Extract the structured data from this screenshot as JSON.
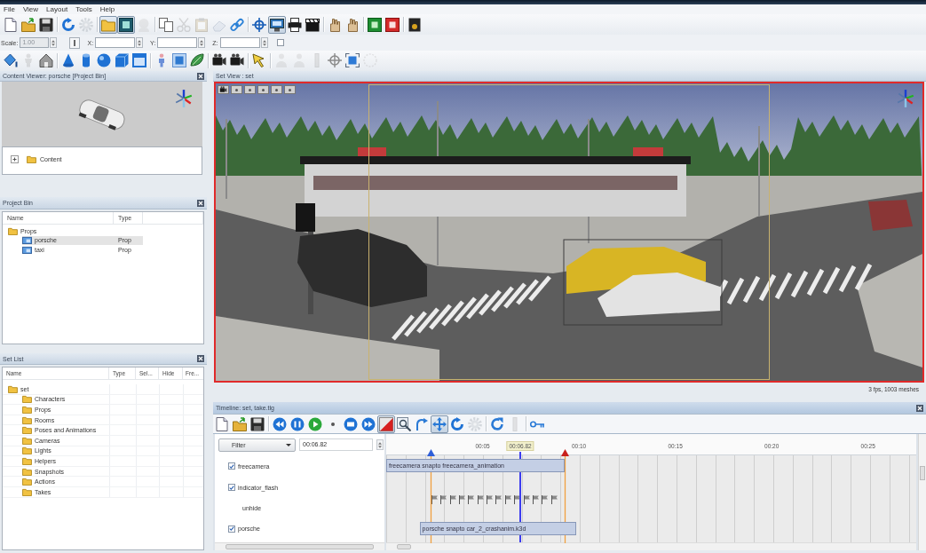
{
  "menu": [
    "File",
    "View",
    "Layout",
    "Tools",
    "Help"
  ],
  "toolbars": {
    "main": [
      {
        "kind": "button",
        "pressed": false,
        "disabled": false
      },
      {
        "kind": "button",
        "pressed": false,
        "disabled": false
      },
      {
        "kind": "button",
        "pressed": false,
        "disabled": false
      },
      {
        "kind": "separator"
      },
      {
        "kind": "button",
        "pressed": false,
        "disabled": false
      },
      {
        "kind": "button",
        "pressed": false,
        "disabled": true
      },
      {
        "kind": "separator"
      },
      {
        "kind": "button",
        "pressed": true,
        "disabled": false
      },
      {
        "kind": "button",
        "pressed": true,
        "disabled": false
      },
      {
        "kind": "button",
        "pressed": false,
        "disabled": true
      },
      {
        "kind": "separator"
      },
      {
        "kind": "button",
        "pressed": false,
        "disabled": false
      },
      {
        "kind": "button",
        "pressed": false,
        "disabled": true
      },
      {
        "kind": "button",
        "pressed": false,
        "disabled": true
      },
      {
        "kind": "button",
        "pressed": false,
        "disabled": true
      },
      {
        "kind": "button",
        "pressed": false,
        "disabled": false
      },
      {
        "kind": "separator"
      },
      {
        "kind": "button",
        "pressed": false,
        "disabled": false
      },
      {
        "kind": "button",
        "pressed": true,
        "disabled": false
      },
      {
        "kind": "button",
        "pressed": false,
        "disabled": false
      },
      {
        "kind": "button",
        "pressed": false,
        "disabled": false
      },
      {
        "kind": "separator"
      },
      {
        "kind": "button",
        "pressed": false,
        "disabled": false
      },
      {
        "kind": "button",
        "pressed": false,
        "disabled": false
      },
      {
        "kind": "separator"
      },
      {
        "kind": "button",
        "pressed": false,
        "disabled": false
      },
      {
        "kind": "button",
        "pressed": false,
        "disabled": false
      },
      {
        "kind": "separator"
      },
      {
        "kind": "button",
        "pressed": false,
        "disabled": false
      }
    ],
    "transform": {
      "fields": [
        {
          "label": "Scale:",
          "value": "1.00",
          "disabled": true
        },
        {
          "label": "X:",
          "disabled": false
        },
        {
          "label": "Y:",
          "disabled": false
        },
        {
          "label": "Z:",
          "disabled": false
        }
      ],
      "toggle": {
        "checked": false
      }
    },
    "create": [
      {
        "kind": "button",
        "pressed": false,
        "disabled": false
      },
      {
        "kind": "button",
        "pressed": false,
        "disabled": true
      },
      {
        "kind": "button",
        "pressed": false,
        "disabled": false
      },
      {
        "kind": "separator"
      },
      {
        "kind": "button",
        "pressed": false,
        "disabled": false
      },
      {
        "kind": "button",
        "pressed": false,
        "disabled": false
      },
      {
        "kind": "button",
        "pressed": false,
        "disabled": false
      },
      {
        "kind": "button",
        "pressed": false,
        "disabled": false
      },
      {
        "kind": "button",
        "pressed": false,
        "disabled": false
      },
      {
        "kind": "separator"
      },
      {
        "kind": "button",
        "pressed": false,
        "disabled": false
      },
      {
        "kind": "button",
        "pressed": false,
        "disabled": false
      },
      {
        "kind": "button",
        "pressed": false,
        "disabled": false
      },
      {
        "kind": "separator"
      },
      {
        "kind": "button",
        "pressed": false,
        "disabled": false
      },
      {
        "kind": "button",
        "pressed": false,
        "disabled": false
      },
      {
        "kind": "separator"
      },
      {
        "kind": "button",
        "pressed": false,
        "disabled": false
      },
      {
        "kind": "separator"
      },
      {
        "kind": "button",
        "pressed": false,
        "disabled": true
      },
      {
        "kind": "button",
        "pressed": false,
        "disabled": true
      },
      {
        "kind": "button",
        "pressed": false,
        "disabled": true
      },
      {
        "kind": "button",
        "pressed": false,
        "disabled": false
      },
      {
        "kind": "button",
        "pressed": false,
        "disabled": false
      },
      {
        "kind": "button",
        "pressed": false,
        "disabled": true
      }
    ]
  },
  "content_viewer": {
    "title": "Content Viewer: porsche [Project Bin]",
    "tree": [
      {
        "label": "Content",
        "expanded": false
      }
    ]
  },
  "project_bin": {
    "title": "Project Bin",
    "columns": [
      "Name",
      "Type"
    ],
    "items": [
      {
        "name": "Props",
        "selected": false,
        "children": [
          {
            "name": "porsche",
            "type": "Prop",
            "selected": true
          },
          {
            "name": "taxi",
            "type": "Prop",
            "selected": false
          }
        ]
      }
    ]
  },
  "set_list": {
    "title": "Set List",
    "columns": [
      "Name",
      "Type",
      "Sel...",
      "Hide",
      "Fre..."
    ],
    "items": [
      {
        "name": "set",
        "children": [
          {
            "name": "Characters"
          },
          {
            "name": "Props"
          },
          {
            "name": "Rooms"
          },
          {
            "name": "Poses and Animations"
          },
          {
            "name": "Cameras"
          },
          {
            "name": "Lights"
          },
          {
            "name": "Helpers"
          },
          {
            "name": "Snapshots"
          },
          {
            "name": "Actions"
          },
          {
            "name": "Takes"
          }
        ]
      }
    ]
  },
  "set_view": {
    "title": "Set View : set",
    "status": "3 fps, 1003 meshes"
  },
  "timeline": {
    "title": "Timeline: set, take.tlg",
    "toolbar": [
      {
        "kind": "button",
        "pressed": false,
        "disabled": false
      },
      {
        "kind": "button",
        "pressed": false,
        "disabled": false
      },
      {
        "kind": "button",
        "pressed": false,
        "disabled": false
      },
      {
        "kind": "separator"
      },
      {
        "kind": "button",
        "pressed": false,
        "disabled": false
      },
      {
        "kind": "button",
        "pressed": false,
        "disabled": false
      },
      {
        "kind": "button",
        "pressed": false,
        "disabled": false
      },
      {
        "kind": "button",
        "pressed": false,
        "disabled": false
      },
      {
        "kind": "button",
        "pressed": false,
        "disabled": false
      },
      {
        "kind": "button",
        "pressed": false,
        "disabled": false
      },
      {
        "kind": "button",
        "pressed": true,
        "disabled": false
      },
      {
        "kind": "button",
        "pressed": false,
        "disabled": false
      },
      {
        "kind": "button",
        "pressed": false,
        "disabled": false
      },
      {
        "kind": "button",
        "pressed": true,
        "disabled": false
      },
      {
        "kind": "button",
        "pressed": false,
        "disabled": false
      },
      {
        "kind": "button",
        "pressed": false,
        "disabled": true
      },
      {
        "kind": "separator"
      },
      {
        "kind": "button",
        "pressed": false,
        "disabled": false
      },
      {
        "kind": "button",
        "pressed": false,
        "disabled": true
      },
      {
        "kind": "separator"
      },
      {
        "kind": "button",
        "pressed": false,
        "disabled": false
      }
    ],
    "filter": {
      "label": "Filter"
    },
    "time": {
      "value": "00:06.82"
    },
    "tracks": [
      {
        "kind": "object",
        "name": "freecamera",
        "checked": true,
        "clip": "freecamera snapto freecamera_animation"
      },
      {
        "kind": "object",
        "name": "indicator_flash",
        "checked": true
      },
      {
        "kind": "action",
        "name": "unhide"
      },
      {
        "kind": "object",
        "name": "porsche",
        "checked": true,
        "clip": "porsche snapto car_2_crashanim.k3d"
      }
    ],
    "ruler": [
      "00:05",
      "00:10",
      "00:15",
      "00:20",
      "00:25"
    ],
    "playhead": {
      "label": "00:06.82",
      "level": 0.253
    },
    "range_start": {
      "level": 0.085
    },
    "range_end": {
      "level": 0.337
    }
  }
}
